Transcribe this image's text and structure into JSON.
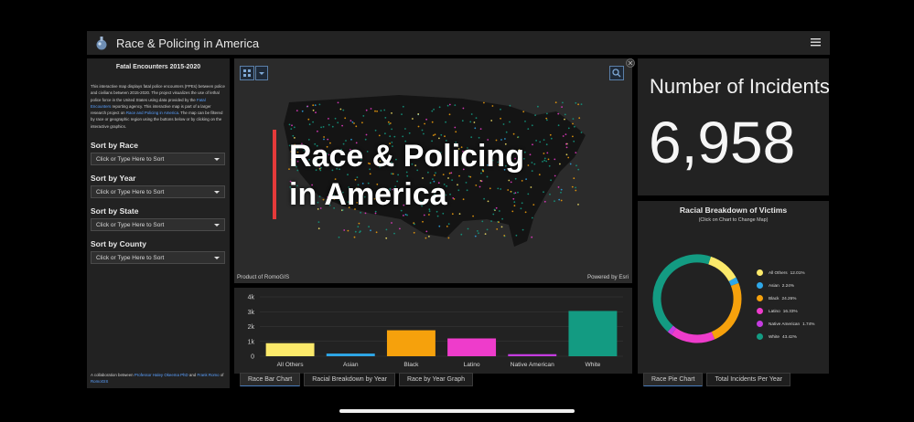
{
  "header": {
    "title": "Race & Policing in America"
  },
  "left_panel": {
    "title": "Fatal Encounters 2015-2020",
    "description": "This interactive map displays fatal police encounters (FPEs) between police and civilians between 2015-2020. The project visualizes the use of lethal police force in the United States using data provided by the",
    "description_link": "Fatal Encounters",
    "description_mid": "reporting agency. This interactive map is part of a larger research project on",
    "description_link2": "Race and Policing in America",
    "description_end": ". The map can be filtered by race or geographic region using the buttons below or by clicking on the interactive graphics.",
    "filters": [
      {
        "label": "Sort by Race",
        "placeholder": "Click or Type Here to Sort"
      },
      {
        "label": "Sort by Year",
        "placeholder": "Click or Type Here to Sort"
      },
      {
        "label": "Sort by State",
        "placeholder": "Click or Type Here to Sort"
      },
      {
        "label": "Sort by County",
        "placeholder": "Click or Type Here to Sort"
      }
    ],
    "collab_prefix": "A collaboration between",
    "collab_link1": "Professor Haley Okeema PhD",
    "collab_mid": "and",
    "collab_link2": "Frank Romo",
    "collab_suffix": "of",
    "collab_link3": "RomoGIS"
  },
  "map": {
    "overlay_title_line1": "Race & Policing",
    "overlay_title_line2": "in America",
    "attribution_left": "Product of RomoGIS",
    "attribution_right": "Powered by Esri"
  },
  "count": {
    "label": "Number of Incidents",
    "value": "6,958"
  },
  "chart_data": [
    {
      "type": "bar",
      "categories": [
        "All Others",
        "Asian",
        "Black",
        "Latino",
        "Native American",
        "White"
      ],
      "values": [
        880,
        180,
        1750,
        1200,
        140,
        3050
      ],
      "colors": [
        "#fbe96a",
        "#2ea7e8",
        "#f6a10c",
        "#ee3ccb",
        "#c43ce0",
        "#139b82"
      ],
      "ylim": [
        0,
        4000
      ],
      "yticks": [
        0,
        1000,
        2000,
        3000,
        4000
      ],
      "ytick_labels": [
        "0",
        "1k",
        "2k",
        "3k",
        "4k"
      ],
      "grid": true
    },
    {
      "type": "pie",
      "title": "Racial Breakdown of Victims",
      "subtitle": "(Click on Chart to Change Map)",
      "labels": [
        "All Others",
        "Asian",
        "Black",
        "Latino",
        "Native American",
        "White"
      ],
      "values": [
        12.01,
        2.24,
        24.26,
        16.33,
        1.74,
        43.42
      ],
      "pct_labels": [
        "12.01%",
        "2.24%",
        "24.26%",
        "16.33%",
        "1.74%",
        "43.42%"
      ],
      "colors": [
        "#fbe96a",
        "#2ea7e8",
        "#f6a10c",
        "#ee3ccb",
        "#c43ce0",
        "#139b82"
      ],
      "donut": true,
      "legend": "right"
    }
  ],
  "tabs_left": [
    "Race Bar Chart",
    "Racial Breakdown by Year",
    "Race by Year Graph"
  ],
  "tabs_right": [
    "Race Pie Chart",
    "Total Incidents Per Year"
  ],
  "icons": {
    "logo": "globe-logo-icon",
    "menu": "hamburger-menu-icon",
    "basemap": "basemap-gallery-icon",
    "search": "search-icon",
    "expand": "expand-icon"
  }
}
